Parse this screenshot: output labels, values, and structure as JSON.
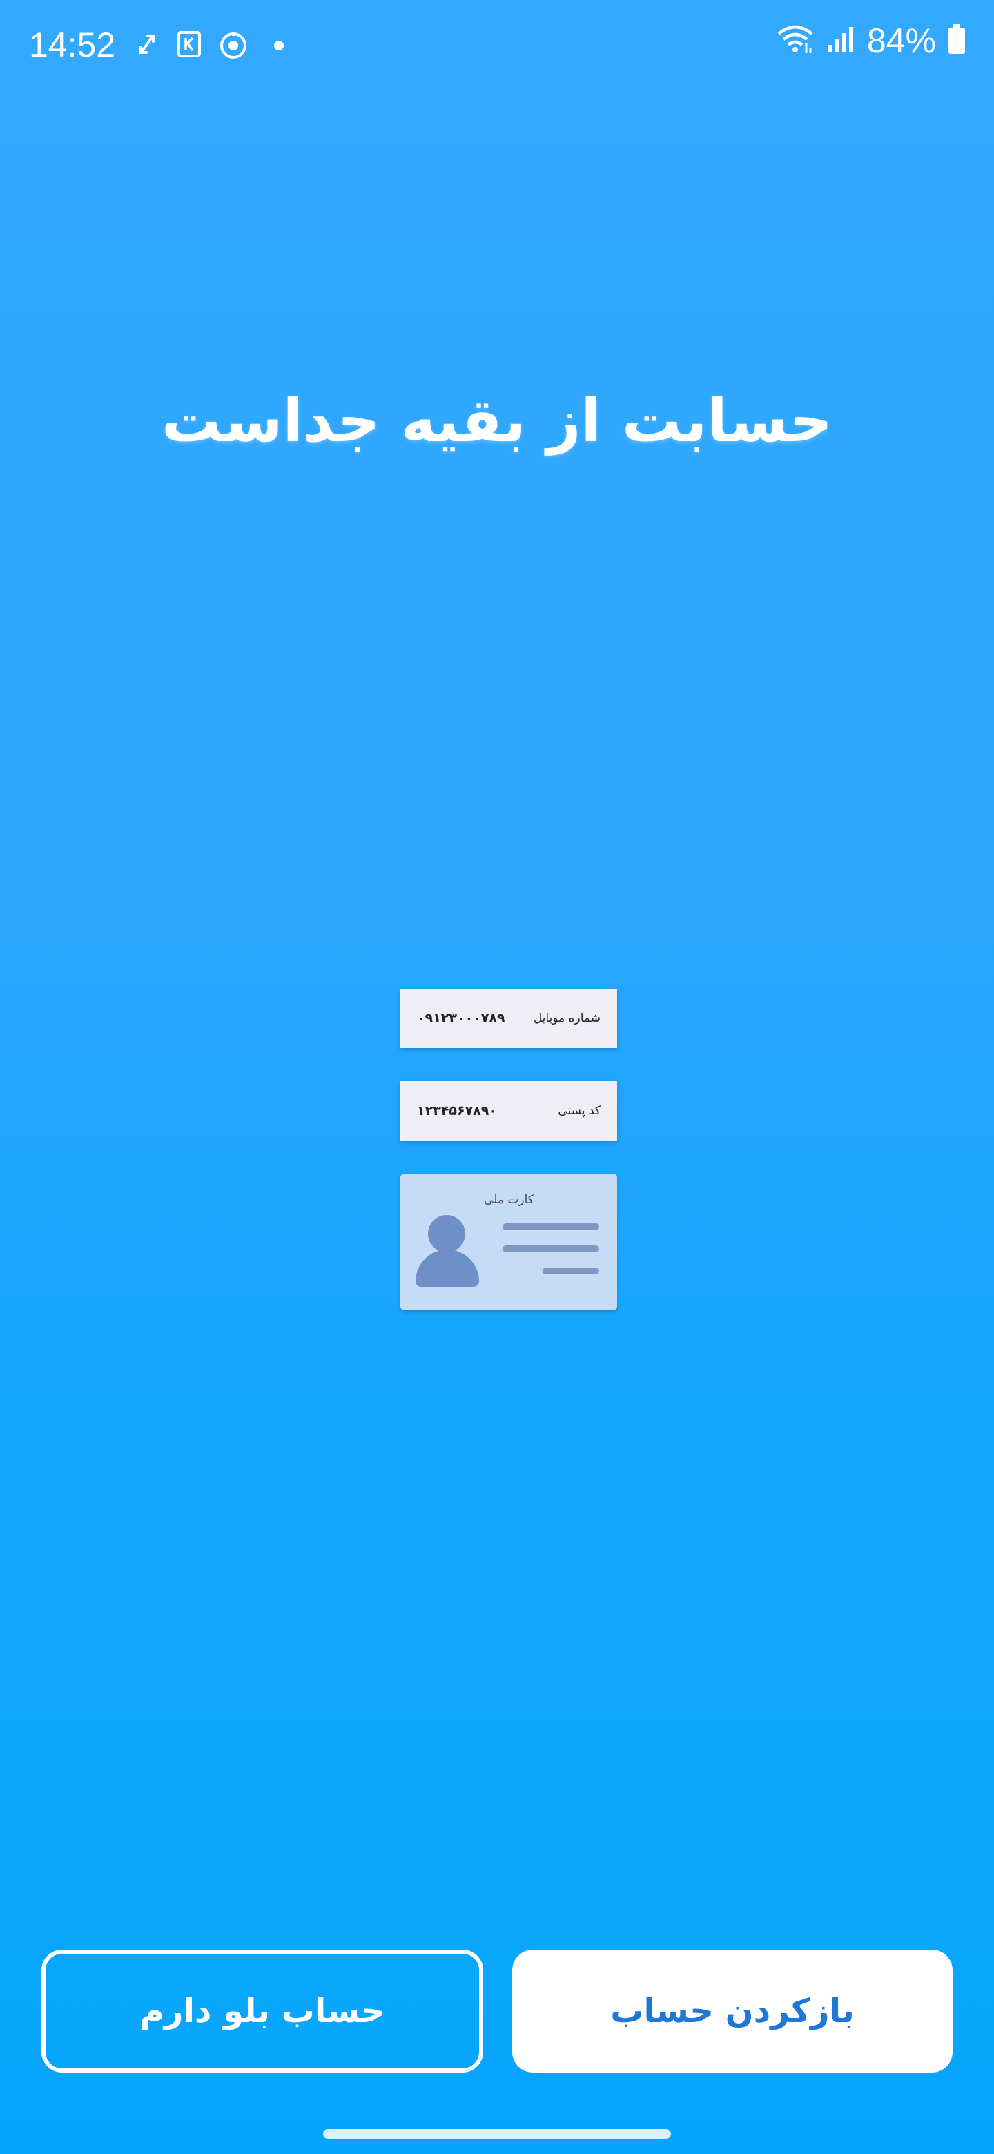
{
  "status_bar": {
    "time": "14:52",
    "battery": "84%"
  },
  "onboarding": {
    "headline": "حسابت از بقیه جداست"
  },
  "illustration": {
    "mobile_label": "شماره موبایل",
    "mobile_value": "۰۹۱۲۳۰۰۰۷۸۹",
    "postal_label": "کد پستی",
    "postal_value": "۱۲۳۴۵۶۷۸۹۰",
    "id_card_title": "کارت ملی"
  },
  "actions": {
    "have_account": "حساب بلو دارم",
    "open_account": "بازکردن حساب"
  },
  "colors": {
    "background": "#2aa6fb",
    "primary_text": "#1f78d6"
  }
}
